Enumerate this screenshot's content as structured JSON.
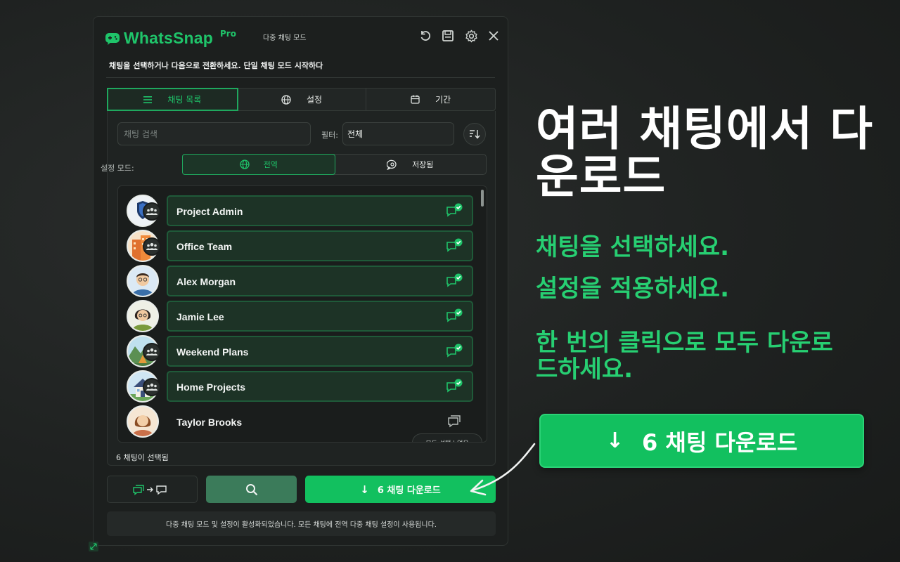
{
  "app": {
    "name": "WhatsSnap",
    "badge": "Pro",
    "mode_label": "다중 채팅 모드",
    "subtitle": "채팅을 선택하거나 다음으로 전환하세요. 단일 채팅 모드 시작하다"
  },
  "tabs": [
    {
      "label": "채팅 목록",
      "icon": "list-icon",
      "active": true
    },
    {
      "label": "설정",
      "icon": "globe-icon",
      "active": false
    },
    {
      "label": "기간",
      "icon": "calendar-icon",
      "active": false
    }
  ],
  "search": {
    "placeholder": "채팅 검색",
    "value": ""
  },
  "filter": {
    "label": "필터:",
    "value": "전체"
  },
  "settings_mode": {
    "label": "설정 모드:",
    "options": [
      {
        "label": "전역",
        "icon": "globe-icon",
        "active": true
      },
      {
        "label": "저장됨",
        "icon": "chat-gear-icon",
        "active": false
      }
    ]
  },
  "chats": [
    {
      "name": "Project Admin",
      "group": true,
      "selected": true
    },
    {
      "name": "Office Team",
      "group": true,
      "selected": true
    },
    {
      "name": "Alex Morgan",
      "group": false,
      "selected": true
    },
    {
      "name": "Jamie Lee",
      "group": false,
      "selected": true
    },
    {
      "name": "Weekend Plans",
      "group": true,
      "selected": true
    },
    {
      "name": "Home Projects",
      "group": true,
      "selected": true
    },
    {
      "name": "Taylor Brooks",
      "group": false,
      "selected": false
    }
  ],
  "select_all": "모두 선택 | 없음",
  "selected_count": "6 채팅이 선택됨",
  "download_button": "6 채팅 다운로드",
  "status_message": "다중 채팅 모드 및 설정이 활성화되었습니다. 모든 채팅에 전역 다중 채팅 설정이 사용됩니다.",
  "hero": {
    "title": "여러 채팅에서 다운로드",
    "line1": "채팅을 선택하세요.",
    "line2": "설정을 적용하세요.",
    "line3": "한 번의 클릭으로 모두 다운로드하세요.",
    "button": "6 채팅 다운로드"
  },
  "colors": {
    "accent": "#12c05f",
    "accent_text": "#27cf72",
    "panel_bg": "#1c1f1e",
    "selected_row": "#1d3326"
  }
}
